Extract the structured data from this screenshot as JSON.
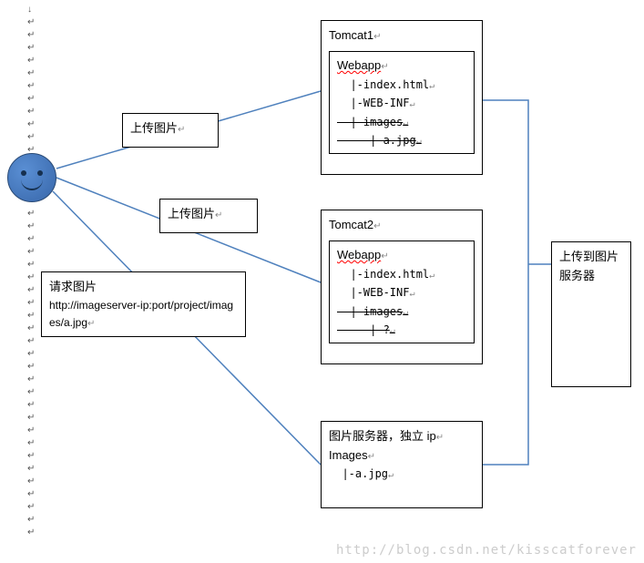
{
  "smiley": {
    "name": "client-smiley"
  },
  "upload1": {
    "label": "上传图片"
  },
  "upload2": {
    "label": "上传图片"
  },
  "request": {
    "title": "请求图片",
    "url_line1": "http://imageserver-ip:port/project/imag",
    "url_line2": "es/a.jpg"
  },
  "tomcat1": {
    "title": "Tomcat1",
    "webapp": {
      "title": "Webapp",
      "lines": [
        "  |-index.html",
        "  |-WEB-INF",
        "  | images",
        "     | a.jpg"
      ],
      "strike_indices": [
        2,
        3
      ]
    }
  },
  "tomcat2": {
    "title": "Tomcat2",
    "webapp": {
      "title": "Webapp",
      "lines": [
        "  |-index.html",
        "  |-WEB-INF",
        "  | images",
        "     | ?"
      ],
      "strike_indices": [
        2,
        3
      ]
    }
  },
  "imgserver": {
    "title": "图片服务器，独立 ip",
    "subtitle": "Images",
    "line": "  |-a.jpg"
  },
  "uploadto": {
    "line1": "上传到图片",
    "line2": "服务器"
  },
  "watermark": "http://blog.csdn.net/kisscatforever"
}
